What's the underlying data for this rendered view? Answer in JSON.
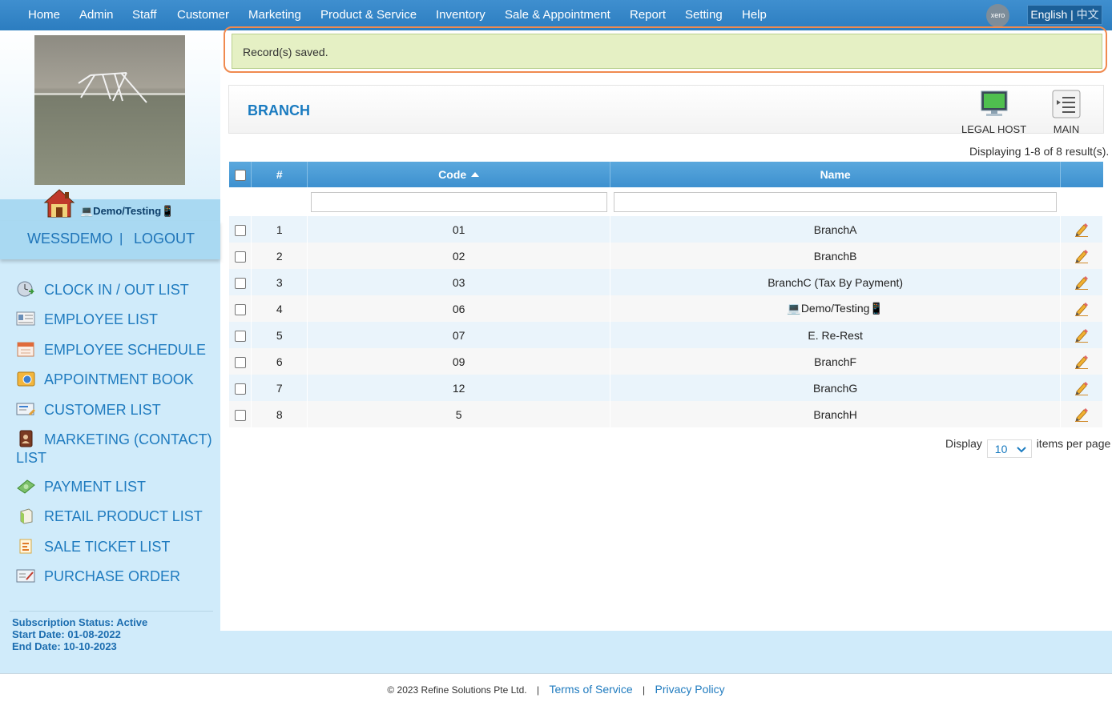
{
  "nav": {
    "items": [
      "Home",
      "Admin",
      "Staff",
      "Customer",
      "Marketing",
      "Product & Service",
      "Inventory",
      "Sale & Appointment",
      "Report",
      "Setting",
      "Help"
    ],
    "xero": "xero",
    "lang_en": "English",
    "lang_sep": "|",
    "lang_zh": "中文"
  },
  "sidebar": {
    "branch": "💻Demo/Testing📱",
    "user": "WESSDEMO",
    "sep": "|",
    "logout": "LOGOUT",
    "menu": [
      {
        "label": "CLOCK IN / OUT LIST",
        "icon": "clock-icon"
      },
      {
        "label": "EMPLOYEE LIST",
        "icon": "employee-card-icon"
      },
      {
        "label": "EMPLOYEE SCHEDULE",
        "icon": "calendar-icon"
      },
      {
        "label": "APPOINTMENT BOOK",
        "icon": "appointment-book-icon"
      },
      {
        "label": "CUSTOMER LIST",
        "icon": "customer-card-icon"
      },
      {
        "label": "MARKETING (CONTACT) LIST",
        "icon": "contact-book-icon"
      },
      {
        "label": "PAYMENT LIST",
        "icon": "money-icon"
      },
      {
        "label": "RETAIL PRODUCT LIST",
        "icon": "product-box-icon"
      },
      {
        "label": "SALE TICKET LIST",
        "icon": "ticket-icon"
      },
      {
        "label": "PURCHASE ORDER",
        "icon": "purchase-order-icon"
      }
    ],
    "subscription": {
      "status": "Subscription Status: Active",
      "start": "Start Date: 01-08-2022",
      "end": "End Date: 10-10-2023"
    }
  },
  "alert": {
    "message": "Record(s) saved."
  },
  "panel": {
    "title": "BRANCH",
    "legal_host_label": "LEGAL HOST",
    "main_label": "MAIN"
  },
  "grid": {
    "result_text": "Displaying 1-8 of 8 result(s).",
    "col_num": "#",
    "col_code": "Code",
    "col_name": "Name",
    "rows": [
      {
        "num": "1",
        "code": "01",
        "name": "BranchA"
      },
      {
        "num": "2",
        "code": "02",
        "name": "BranchB"
      },
      {
        "num": "3",
        "code": "03",
        "name": "BranchC (Tax By Payment)"
      },
      {
        "num": "4",
        "code": "06",
        "name": "💻Demo/Testing📱"
      },
      {
        "num": "5",
        "code": "07",
        "name": "E. Re-Rest"
      },
      {
        "num": "6",
        "code": "09",
        "name": "BranchF"
      },
      {
        "num": "7",
        "code": "12",
        "name": "BranchG"
      },
      {
        "num": "8",
        "code": "5",
        "name": "BranchH"
      }
    ]
  },
  "pager": {
    "prefix": "Display",
    "value": "10",
    "suffix": "items per page"
  },
  "footer": {
    "copyright": "© 2023 Refine Solutions Pte Ltd.",
    "sep": "|",
    "terms": "Terms of Service",
    "privacy": "Privacy Policy"
  },
  "colors": {
    "accent": "#1f7bbf",
    "nav_bg": "#3584c6",
    "alert_border": "#f08a4f",
    "alert_bg": "#e5f0c4"
  }
}
